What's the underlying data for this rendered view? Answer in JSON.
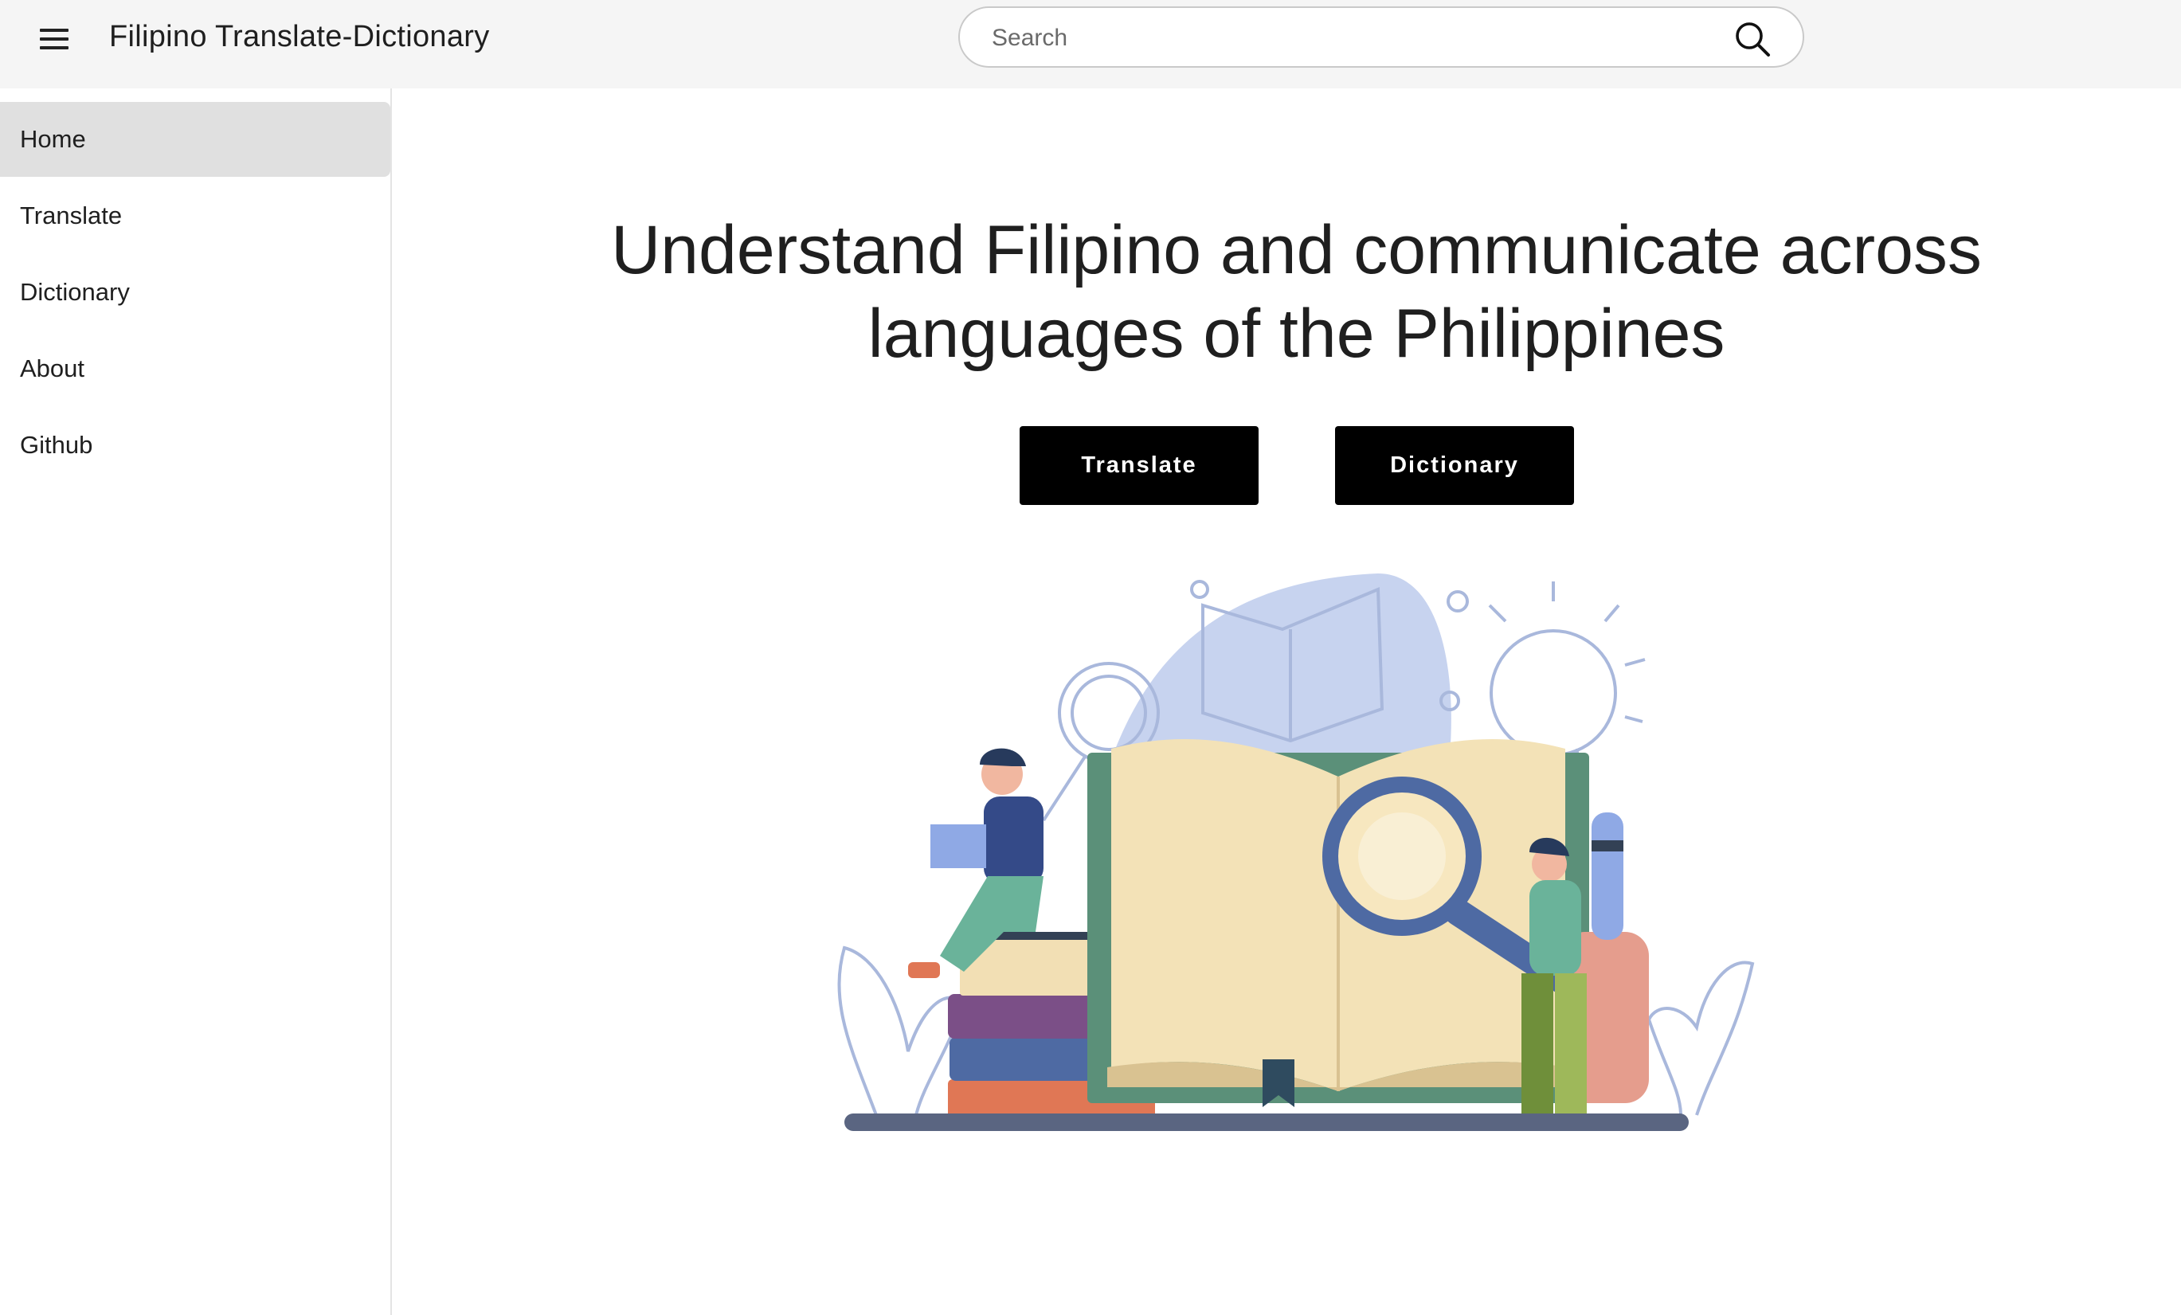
{
  "appbar": {
    "title": "Filipino Translate-Dictionary",
    "menu_icon": "hamburger-menu-icon",
    "search": {
      "placeholder": "Search",
      "value": "",
      "icon": "search-icon"
    }
  },
  "sidebar": {
    "items": [
      {
        "label": "Home",
        "active": true
      },
      {
        "label": "Translate",
        "active": false
      },
      {
        "label": "Dictionary",
        "active": false
      },
      {
        "label": "About",
        "active": false
      },
      {
        "label": "Github",
        "active": false
      }
    ]
  },
  "main": {
    "headline_line1": "Understand Filipino and communicate across",
    "headline_line2": "languages of the Philippines",
    "buttons": [
      {
        "label": "Translate"
      },
      {
        "label": "Dictionary"
      }
    ],
    "illustration": "open-book-study-illustration"
  },
  "colors": {
    "appbar_bg": "#f5f5f5",
    "active_nav_bg": "#e0e0e0",
    "button_bg": "#000000",
    "button_text": "#ffffff",
    "blob": "#c7d3ef"
  }
}
